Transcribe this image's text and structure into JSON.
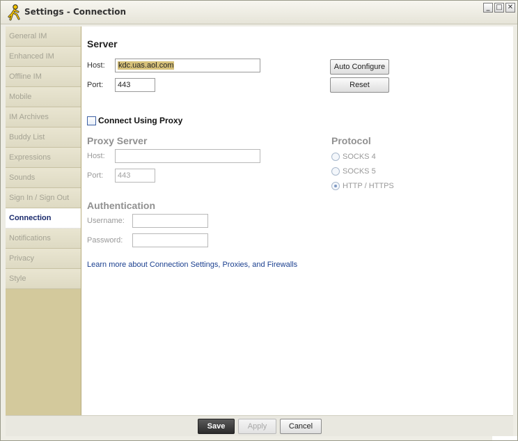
{
  "window": {
    "title": "Settings - Connection",
    "controls": [
      "minimize-icon",
      "maximize-icon",
      "close-icon"
    ]
  },
  "sidebar": {
    "items": [
      {
        "label": "General IM",
        "active": false
      },
      {
        "label": "Enhanced IM",
        "active": false
      },
      {
        "label": "Offline IM",
        "active": false
      },
      {
        "label": "Mobile",
        "active": false
      },
      {
        "label": "IM Archives",
        "active": false
      },
      {
        "label": "Buddy List",
        "active": false
      },
      {
        "label": "Expressions",
        "active": false
      },
      {
        "label": "Sounds",
        "active": false
      },
      {
        "label": "Sign In / Sign Out",
        "active": false
      },
      {
        "label": "Connection",
        "active": true
      },
      {
        "label": "Notifications",
        "active": false
      },
      {
        "label": "Privacy",
        "active": false
      },
      {
        "label": "Style",
        "active": false
      }
    ]
  },
  "server": {
    "heading": "Server",
    "host_label": "Host:",
    "host_value": "kdc.uas.aol.com",
    "port_label": "Port:",
    "port_value": "443",
    "auto_configure_label": "Auto Configure",
    "reset_label": "Reset"
  },
  "proxy": {
    "checkbox_label": "Connect Using Proxy",
    "checked": false,
    "heading": "Proxy Server",
    "host_label": "Host:",
    "host_value": "",
    "port_label": "Port:",
    "port_value": "443"
  },
  "protocol": {
    "heading": "Protocol",
    "options": [
      {
        "label": "SOCKS 4",
        "selected": false
      },
      {
        "label": "SOCKS 5",
        "selected": false
      },
      {
        "label": "HTTP / HTTPS",
        "selected": true
      }
    ]
  },
  "auth": {
    "heading": "Authentication",
    "username_label": "Username:",
    "username_value": "",
    "password_label": "Password:",
    "password_value": ""
  },
  "help": {
    "prefix": "Learn more about ",
    "link1": "Connection Settings",
    "sep1": ", ",
    "link2": "Proxies",
    "sep2": ", and ",
    "link3": "Firewalls"
  },
  "footer": {
    "save_label": "Save",
    "apply_label": "Apply",
    "cancel_label": "Cancel"
  },
  "colors": {
    "sidebar_bg": "#d3c99c",
    "active_nav_text": "#1a2a6c",
    "link": "#1a3f8f",
    "host_highlight": "#d7c17a"
  }
}
